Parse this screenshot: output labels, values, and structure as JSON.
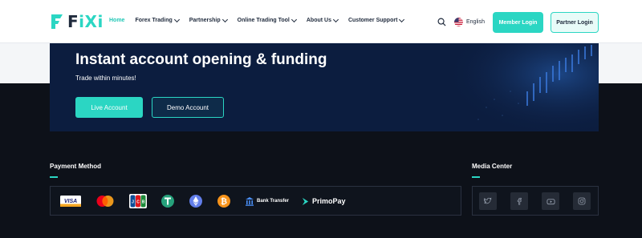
{
  "brand": {
    "name_prefix": "F",
    "name_suffix": "iXi"
  },
  "nav": {
    "items": [
      {
        "label": "Home",
        "has_dropdown": false,
        "active": true
      },
      {
        "label": "Forex Trading",
        "has_dropdown": true
      },
      {
        "label": "Partnership",
        "has_dropdown": true
      },
      {
        "label": "Online Trading Tool",
        "has_dropdown": true
      },
      {
        "label": "About Us",
        "has_dropdown": true
      },
      {
        "label": "Customer Support",
        "has_dropdown": true
      }
    ],
    "language": "English",
    "member_login": "Member Login",
    "partner_login": "Partner Login"
  },
  "hero": {
    "title": "Instant account opening & funding",
    "subtitle": "Trade within minutes!",
    "live_button": "Live Account",
    "demo_button": "Demo Account"
  },
  "footer": {
    "payment_title": "Payment Method",
    "payment_methods": [
      "VISA",
      "Mastercard",
      "JCB",
      "Tether",
      "Ethereum",
      "Bitcoin",
      "Bank Transfer",
      "PrimoPay"
    ],
    "bank_transfer_label": "Bank Transfer",
    "primopay_label": "PrimoPay",
    "media_title": "Media Center",
    "media_icons": [
      "twitter-icon",
      "facebook-icon",
      "youtube-icon",
      "instagram-icon"
    ]
  },
  "colors": {
    "accent": "#2bd6c3",
    "hero_bg": "#0c1d3f",
    "footer_bg": "#0d1119"
  }
}
